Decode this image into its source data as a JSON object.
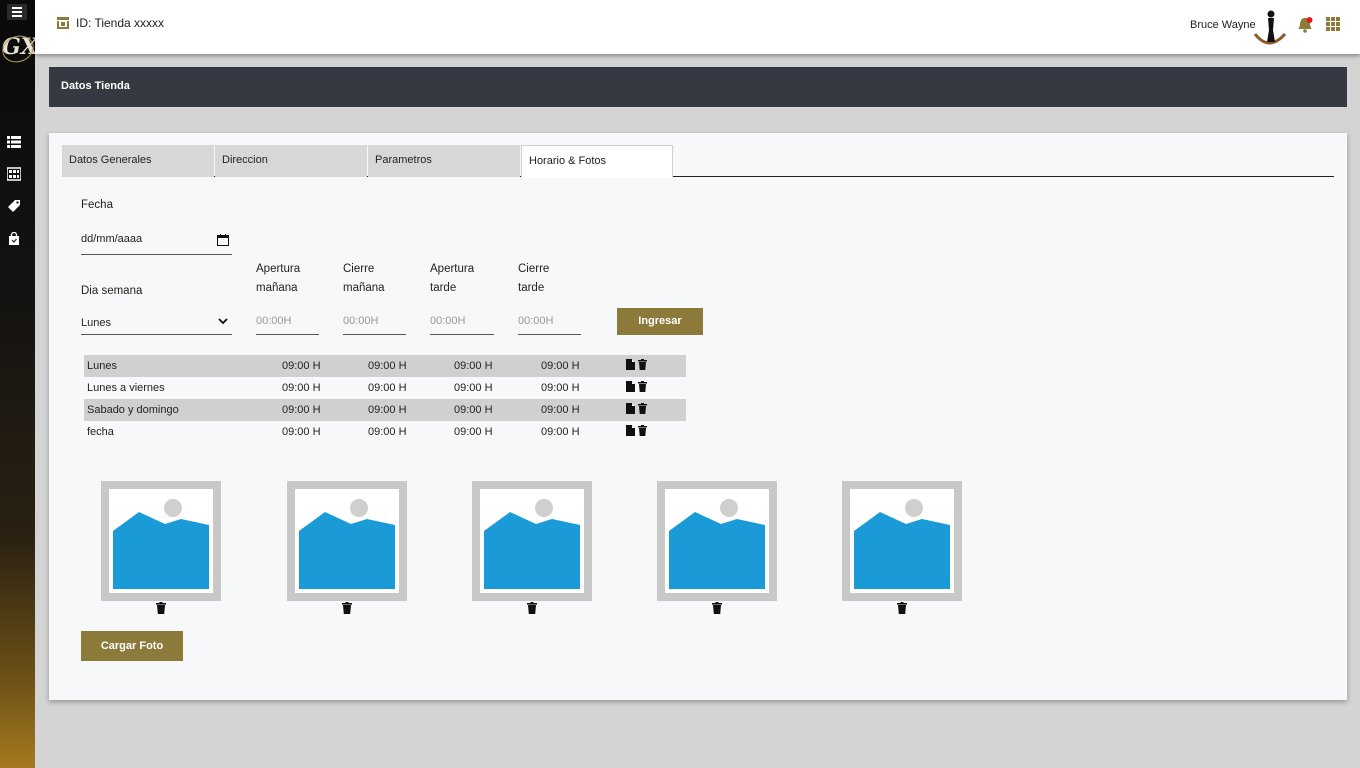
{
  "topbar": {
    "store_id": "ID: Tienda xxxxx",
    "user_name": "Bruce Wayne"
  },
  "band": {
    "title": "Datos Tienda"
  },
  "tabs": [
    {
      "label": "Datos Generales",
      "active": false
    },
    {
      "label": "Direccion",
      "active": false
    },
    {
      "label": "Parametros",
      "active": false
    },
    {
      "label": "Horario & Fotos",
      "active": true
    }
  ],
  "form": {
    "fecha_label": "Fecha",
    "fecha_value": "dd/mm/aaaa",
    "dia_label": "Dia semana",
    "dia_value": "Lunes",
    "apertura_manana": {
      "line1": "Apertura",
      "line2": "mañana",
      "placeholder": "00:00H"
    },
    "cierre_manana": {
      "line1": "Cierre",
      "line2": "mañana",
      "placeholder": "00:00H"
    },
    "apertura_tarde": {
      "line1": "Apertura",
      "line2": "tarde",
      "placeholder": "00:00H"
    },
    "cierre_tarde": {
      "line1": "Cierre",
      "line2": "tarde",
      "placeholder": "00:00H"
    },
    "ingresar_label": "Ingresar"
  },
  "schedule": [
    {
      "day": "Lunes",
      "t1": "09:00 H",
      "t2": "09:00 H",
      "t3": "09:00 H",
      "t4": "09:00 H"
    },
    {
      "day": "Lunes a viernes",
      "t1": "09:00 H",
      "t2": "09:00 H",
      "t3": "09:00 H",
      "t4": "09:00 H"
    },
    {
      "day": "Sabado y domingo",
      "t1": "09:00 H",
      "t2": "09:00 H",
      "t3": "09:00 H",
      "t4": "09:00 H"
    },
    {
      "day": "fecha",
      "t1": "09:00 H",
      "t2": "09:00 H",
      "t3": "09:00 H",
      "t4": "09:00 H"
    }
  ],
  "photos_count": 5,
  "cargar_foto_label": "Cargar Foto",
  "colors": {
    "accent_gold": "#8c7a3a",
    "header_band": "#353a42",
    "image_placeholder_blue": "#1a9ad6",
    "notification_dot": "#e01b1b"
  },
  "icons": [
    "menu-icon",
    "list-icon",
    "store-grid-icon",
    "tag-icon",
    "bag-icon",
    "store-icon",
    "bell-icon",
    "apps-grid-icon",
    "calendar-icon",
    "chevron-down-icon",
    "file-icon",
    "trash-icon",
    "image-placeholder-icon"
  ]
}
